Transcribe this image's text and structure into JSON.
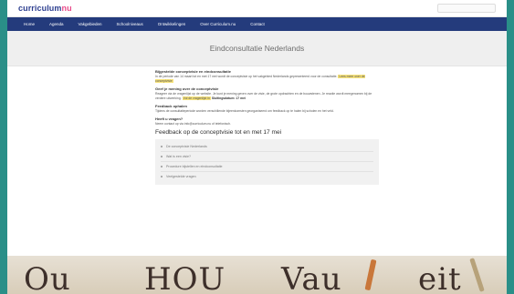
{
  "brand": {
    "logo_main": "curriculum",
    "logo_accent": "nu"
  },
  "nav": {
    "items": [
      "Home",
      "Agenda",
      "Vakgebieden",
      "Schoolniveaus",
      "Ontwikkelingen",
      "Over Curriculum.nu",
      "Contact"
    ]
  },
  "page": {
    "title": "Eindconsultatie Nederlands"
  },
  "sections": [
    {
      "heading": "Bijgestelde conceptvisie en eindconsultatie",
      "text": "In de periode van 14 maart tot en met 17 mei wordt de conceptvisie op het vakgebied Nederlands gepresenteerd voor de consultatie.",
      "link": "Lees meer over de conceptvisie"
    },
    {
      "heading": "Geef je mening over de conceptvisie",
      "text": "Reageer via de vragenlijst op de website. Je kunt je mening geven over de visie, de grote opdrachten en de bouwstenen. Je reactie wordt meegenomen bij de verdere uitwerking.",
      "link": "Vul de vragenlijst in",
      "tail": "Sluitingsdatum: 17 mei"
    },
    {
      "heading": "Feedback ophalen",
      "text": "Tijdens de consultatieperiode worden verschillende bijeenkomsten georganiseerd om feedback op te halen bij scholen en het veld."
    },
    {
      "heading": "Heeft u vragen?",
      "text": "Neem contact op via info@curriculum.nu of telefonisch."
    }
  ],
  "cta": {
    "title": "Feedback op de conceptvisie tot en met 17 mei"
  },
  "card": {
    "items": [
      "De conceptvisie Nederlands",
      "Wat is een visie?",
      "Procedure bijstellen en eindconsultatie",
      "Veelgestelde vragen"
    ]
  },
  "photo": {
    "word_1": "Ou",
    "word_2": "HOU",
    "word_3": "Vau",
    "word_4": "eit"
  }
}
